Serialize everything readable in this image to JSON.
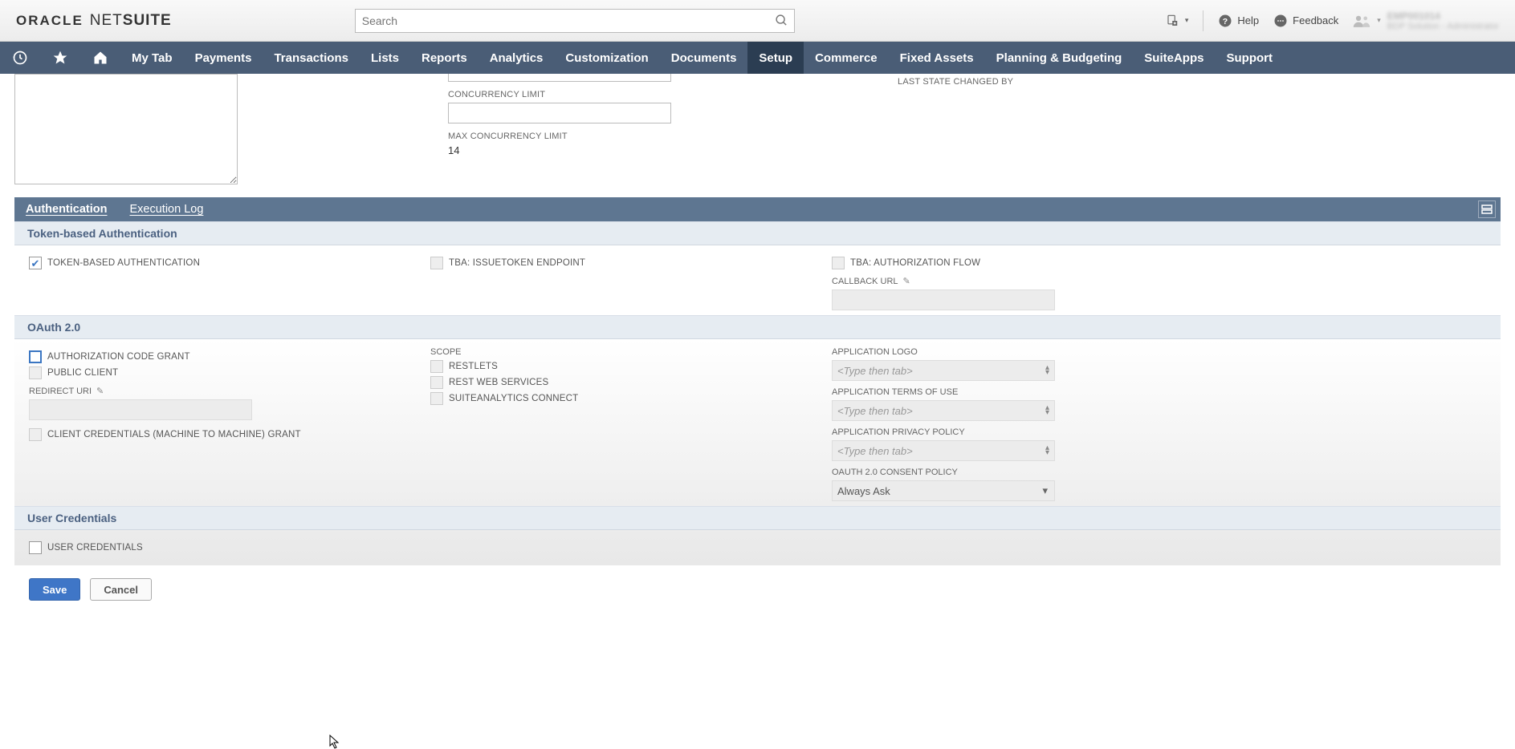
{
  "header": {
    "logo_oracle": "ORACLE",
    "logo_netsuite_light": "NET",
    "logo_netsuite_bold": "SUITE",
    "search_placeholder": "Search",
    "help": "Help",
    "feedback": "Feedback",
    "role_line1": "EMP001014",
    "role_line2": "BDP Solution - Administrator"
  },
  "nav": {
    "items": [
      "My Tab",
      "Payments",
      "Transactions",
      "Lists",
      "Reports",
      "Analytics",
      "Customization",
      "Documents",
      "Setup",
      "Commerce",
      "Fixed Assets",
      "Planning & Budgeting",
      "SuiteApps",
      "Support"
    ],
    "active_index": 8
  },
  "upper": {
    "concurrency_limit_label": "CONCURRENCY LIMIT",
    "max_concurrency_limit_label": "MAX CONCURRENCY LIMIT",
    "max_concurrency_limit_value": "14",
    "last_state_changed_by_label": "LAST STATE CHANGED BY"
  },
  "tabs": {
    "authentication": "Authentication",
    "execution_log": "Execution Log"
  },
  "sections": {
    "tba": {
      "title": "Token-based Authentication",
      "token_based_auth": "TOKEN-BASED AUTHENTICATION",
      "issuetoken": "TBA: ISSUETOKEN ENDPOINT",
      "auth_flow": "TBA: AUTHORIZATION FLOW",
      "callback_url": "CALLBACK URL"
    },
    "oauth": {
      "title": "OAuth 2.0",
      "auth_code_grant": "AUTHORIZATION CODE GRANT",
      "public_client": "PUBLIC CLIENT",
      "redirect_uri": "REDIRECT URI",
      "client_credentials": "CLIENT CREDENTIALS (MACHINE TO MACHINE) GRANT",
      "scope": "SCOPE",
      "restlets": "RESTLETS",
      "rest_web": "REST WEB SERVICES",
      "suiteanalytics": "SUITEANALYTICS CONNECT",
      "app_logo": "APPLICATION LOGO",
      "app_terms": "APPLICATION TERMS OF USE",
      "app_privacy": "APPLICATION PRIVACY POLICY",
      "consent_policy": "OAUTH 2.0 CONSENT POLICY",
      "consent_value": "Always Ask",
      "typeahead_placeholder": "<Type then tab>"
    },
    "user_creds": {
      "title": "User Credentials",
      "user_credentials": "USER CREDENTIALS"
    }
  },
  "footer": {
    "save": "Save",
    "cancel": "Cancel"
  }
}
